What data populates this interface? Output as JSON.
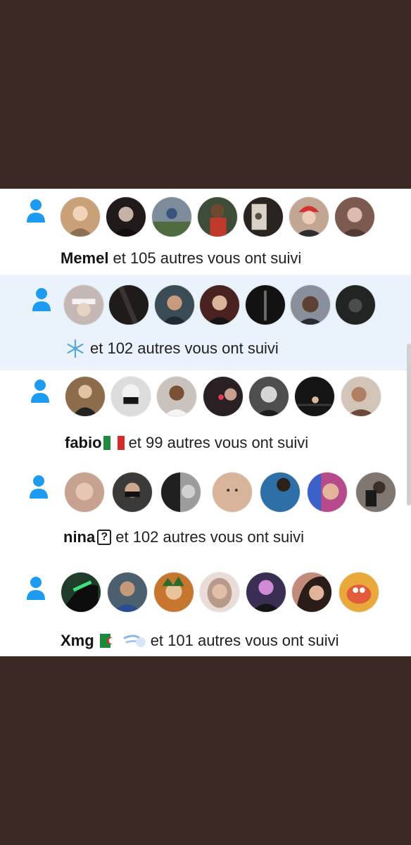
{
  "colors": {
    "frame_bg": "#3b2824",
    "panel_bg": "#ffffff",
    "highlight_bg": "#eaf3fc",
    "icon_blue": "#1d9bf0",
    "text": "#1f1f1f"
  },
  "notifications": [
    {
      "name": "Memel",
      "badges": [],
      "text": "et 105 autres vous ont suivi",
      "highlighted": false,
      "avatars": [
        "#c9a178",
        "#201a1a",
        "#7e8b9a",
        "#3e4d38",
        "#2a2420",
        "#c1a793",
        "#7d5a50"
      ]
    },
    {
      "name": "",
      "badges": [
        "snowflake-icon"
      ],
      "text": "et 102 autres vous ont suivi",
      "highlighted": true,
      "avatars": [
        "#c4b7b4",
        "#1e1b1a",
        "#3b4c56",
        "#4a2320",
        "#121212",
        "#8a8f9c",
        "#222423"
      ]
    },
    {
      "name": "fabio",
      "badges": [
        "italy-flag-icon"
      ],
      "text": "et 99 autres vous ont suivi",
      "highlighted": false,
      "avatars": [
        "#8d6c4b",
        "#dcdcdc",
        "#c9c2bd",
        "#2a1f23",
        "#4e4e4e",
        "#151515",
        "#d3c4b8"
      ]
    },
    {
      "name": "nina",
      "badges": [
        "unknown-glyph-icon"
      ],
      "text": "et 102 autres vous ont suivi",
      "highlighted": false,
      "avatars": [
        "#c8a290",
        "#3c3a38",
        "#9c9c9c",
        "#d8b59a",
        "#2d6fa6",
        "#b64a8c",
        "#7f7670"
      ]
    },
    {
      "name": "Xmg",
      "badges": [
        "algeria-flag-icon",
        "dash-icon"
      ],
      "text": "et 101 autres vous ont suivi",
      "highlighted": false,
      "avatars": [
        "#1f3b2a",
        "#4b5f6e",
        "#c7762f",
        "#e9dcd6",
        "#3a2f52",
        "#c18a7a",
        "#e9a93a"
      ]
    }
  ]
}
